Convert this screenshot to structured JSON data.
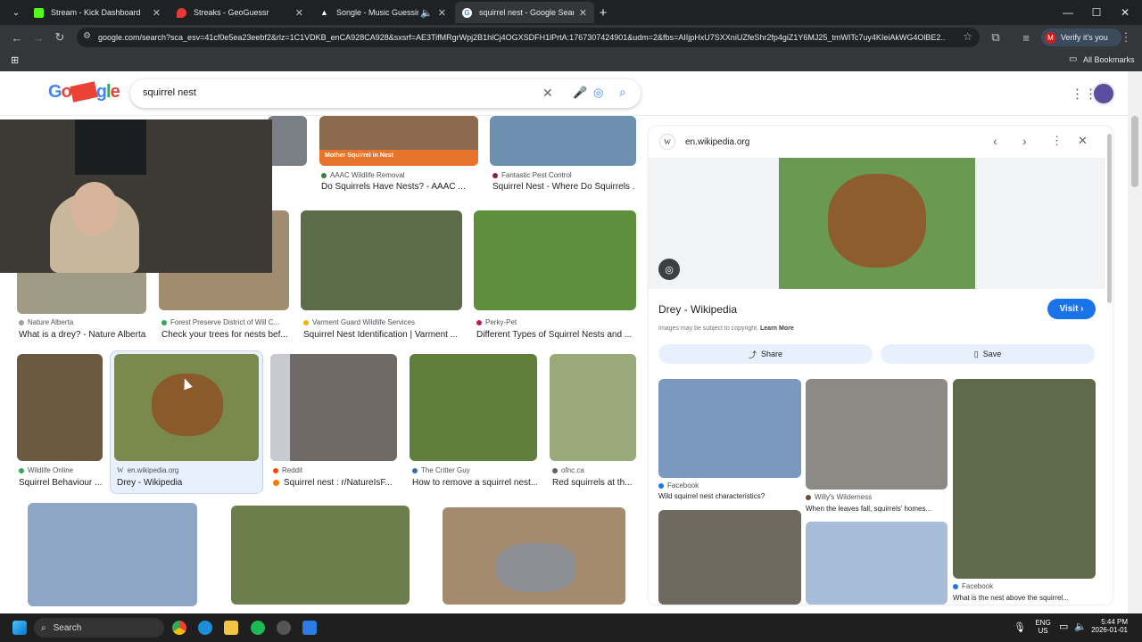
{
  "browser": {
    "tabs": [
      {
        "title": "Stream - Kick Dashboard",
        "color": "#53fc18"
      },
      {
        "title": "Streaks - GeoGuessr",
        "color": "#e53935"
      },
      {
        "title": "Songle - Music Guessing G",
        "color": "#ffffff"
      },
      {
        "title": "squirrel nest - Google Search",
        "color": "#4285f4"
      }
    ],
    "url": "google.com/search?sca_esv=41cf0e5ea23eebf2&rlz=1C1VDKB_enCA928CA928&sxsrf=AE3TifMRgrWpj2B1hlCj4OGXSDFH1lPrtA:1767307424901&udm=2&fbs=AIIjpHxU7SXXniUZfeShr2fp4giZ1Y6MJ25_tmWITc7uy4KIeiAkWG4OlBE2...",
    "verify_label": "Verify it's you",
    "verify_avatar": "M",
    "all_bookmarks": "All Bookmarks"
  },
  "google": {
    "logo": "Google",
    "query": "squirrel nest"
  },
  "results": [
    {
      "source": "AAAC Wildlife Removal",
      "caption": "Do Squirrels Have Nests? - AAAC ...",
      "banner": "Mother Squirrel in Nest"
    },
    {
      "source": "Fantastic Pest Control",
      "caption": "Squirrel Nest - Where Do Squirrels ..."
    },
    {
      "source": "Nature Alberta",
      "caption": "What is a drey? - Nature Alberta"
    },
    {
      "source": "Forest Preserve District of Will C...",
      "caption": "Check your trees for nests bef..."
    },
    {
      "source": "Varment Guard Wildlife Services",
      "caption": "Squirrel Nest Identification | Varment ..."
    },
    {
      "source": "Perky-Pet",
      "caption": "Different Types of Squirrel Nests and ..."
    },
    {
      "source": "Wildlife Online",
      "caption": "Squirrel Behaviour ..."
    },
    {
      "source": "en.wikipedia.org",
      "caption": "Drey - Wikipedia"
    },
    {
      "source": "Reddit",
      "caption": "Squirrel nest : r/NatureIsF..."
    },
    {
      "source": "The Critter Guy",
      "caption": "How to remove a squirrel nest..."
    },
    {
      "source": "ofnc.ca",
      "caption": "Red squirrels at th..."
    }
  ],
  "panel": {
    "site": "en.wikipedia.org",
    "title": "Drey - Wikipedia",
    "visit": "Visit",
    "copyright": "Images may be subject to copyright.",
    "learn_more": "Learn More",
    "share": "Share",
    "save": "Save",
    "related": [
      {
        "source": "Facebook",
        "caption": "Wild squirrel nest characteristics?"
      },
      {
        "source": "Willy's Wilderness",
        "caption": "When the leaves fall, squirrels' homes..."
      },
      {
        "source": "Facebook",
        "caption": "What is the nest above the squirrel..."
      }
    ]
  },
  "taskbar": {
    "search": "Search",
    "lang": "ENG",
    "region": "US",
    "time": "5:44 PM",
    "date": "2026-01-01"
  }
}
